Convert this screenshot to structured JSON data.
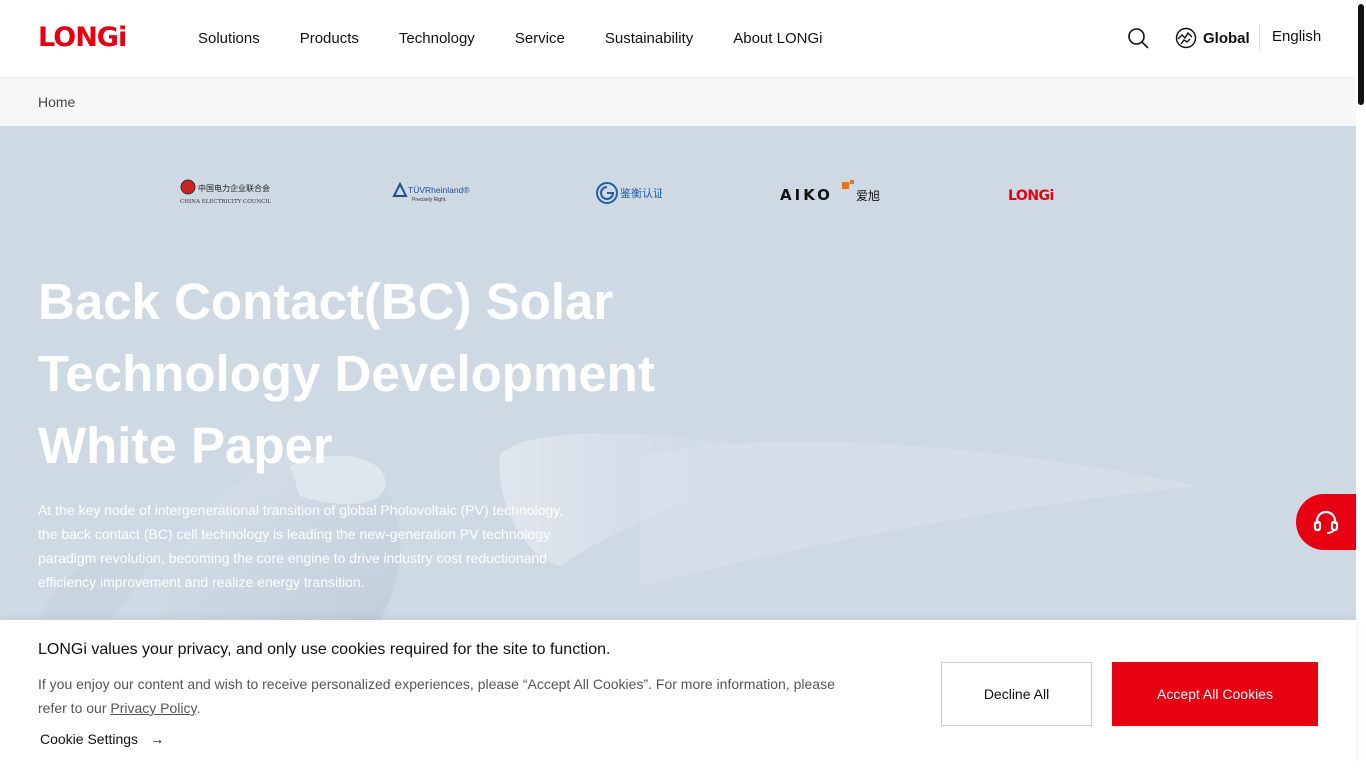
{
  "header": {
    "logo_text": "LONGi",
    "nav": [
      "Solutions",
      "Products",
      "Technology",
      "Service",
      "Sustainability",
      "About LONGi"
    ],
    "global_label": "Global",
    "language": "English"
  },
  "breadcrumb": {
    "home": "Home"
  },
  "hero": {
    "partners": {
      "cec": "中国电力企业联合会",
      "cec_en": "CHINA ELECTRICITY COUNCIL",
      "tuv": "TÜVRheinland®",
      "tuv_tag": "Precisely Right.",
      "jianheng": "鉴衡认证",
      "aiko": "AIKO",
      "aiko_cn": "爱旭",
      "longi": "LONGi"
    },
    "title": "Back Contact(BC) Solar Technology Development White Paper",
    "description": "At the key node of intergenerational transition of global Photovoltaic (PV) technology, the back contact (BC) cell technology is leading the new-generation PV technology paradigm revolution, becoming the core engine to drive industry cost reductionand efficiency improvement and realize energy transition."
  },
  "cookie": {
    "title": "LONGi values your privacy, and only use cookies required for the site to function.",
    "text_before": "If you enjoy our content and wish to receive personalized experiences, please “Accept All Cookies”. For more information, please refer to our ",
    "privacy_link": "Privacy Policy",
    "text_after": ".",
    "settings_label": "Cookie Settings",
    "arrow": "→",
    "decline_label": "Decline All",
    "accept_label": "Accept All Cookies"
  },
  "colors": {
    "brand_red": "#e60012",
    "hero_bg": "#cfd9e4"
  }
}
